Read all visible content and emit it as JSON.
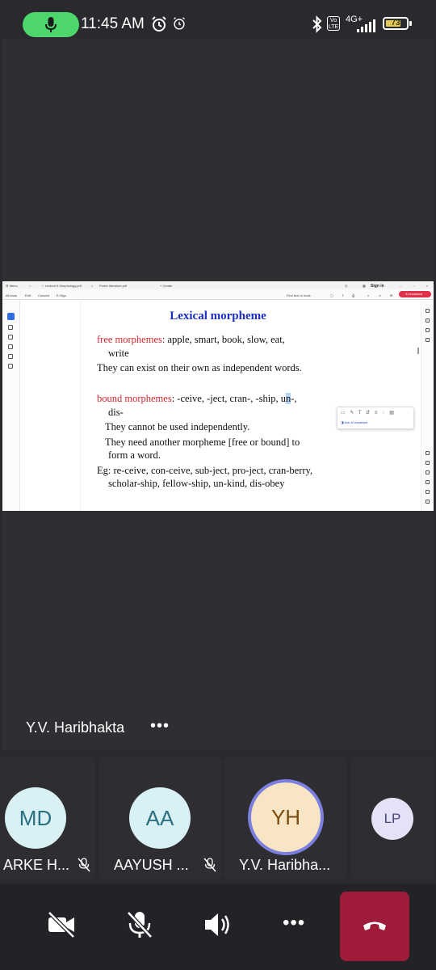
{
  "status_bar": {
    "time": "11:45 AM",
    "volte_label": "Vo LTE",
    "network_label": "4G+",
    "battery_percent": "73",
    "battery_level": 0.73,
    "mic_pill_color": "#4cd66b"
  },
  "pdf_viewer": {
    "tab_menu": "☰ Menu",
    "tab_active": "☆ Lecture 6 Morphology.pdf",
    "tab_second": "Porter literature.pdf",
    "tab_create": "+ Create",
    "toolbar_all_tools": "All tools",
    "toolbar_edit": "Edit",
    "toolbar_convert": "Convert",
    "toolbar_esign": "E-Sign",
    "find_text": "Find text or tools",
    "sign_in": "Sign in",
    "ai_assistant": "AI Assistant",
    "ask_ai": "Ask AI Assistant"
  },
  "document": {
    "title": "Lexical morpheme",
    "free_term": "free morphemes",
    "free_rest": ": apple, smart, book, slow, eat,",
    "free_cont": "write",
    "free_desc": "They can exist on their own as independent words.",
    "bound_term": "bound morphemes",
    "bound_rest": ": -ceive, -ject, cran-, -ship, ",
    "bound_hl_a": "u",
    "bound_hl_b": "n",
    "bound_tail": "-,",
    "bound_cont": "dis-",
    "bound_desc1": "They cannot be used independently.",
    "bound_desc2a": "They need another morpheme [free or bound] to",
    "bound_desc2b": "form a word.",
    "eg1": "Eg: re-ceive, con-ceive, sub-ject, pro-ject, cran-berry,",
    "eg2": "scholar-ship, fellow-ship, un-kind, dis-obey"
  },
  "presenter": {
    "name": "Y.V. Haribhakta",
    "more": "•••"
  },
  "participants": [
    {
      "initials": "MD",
      "name": "ARKE H...",
      "muted": true,
      "avatar_color": "#d9f1f4",
      "text_color": "#2b6f82"
    },
    {
      "initials": "AA",
      "name": "AAYUSH ...",
      "muted": true,
      "avatar_color": "#d9f1f4",
      "text_color": "#2b6f82"
    },
    {
      "initials": "YH",
      "name": "Y.V. Haribha...",
      "muted": false,
      "avatar_color": "#f7e5c3",
      "text_color": "#7a4c12",
      "ring_color": "#7b7fe0"
    },
    {
      "initials": "LP",
      "name": "",
      "muted": false,
      "avatar_color": "#e4e2f6",
      "text_color": "#4a4380"
    }
  ],
  "controls": {
    "camera": "camera-off",
    "mic": "mic-off",
    "speaker": "speaker-on",
    "more": "•••",
    "end_call_color": "#9e1c3a"
  }
}
